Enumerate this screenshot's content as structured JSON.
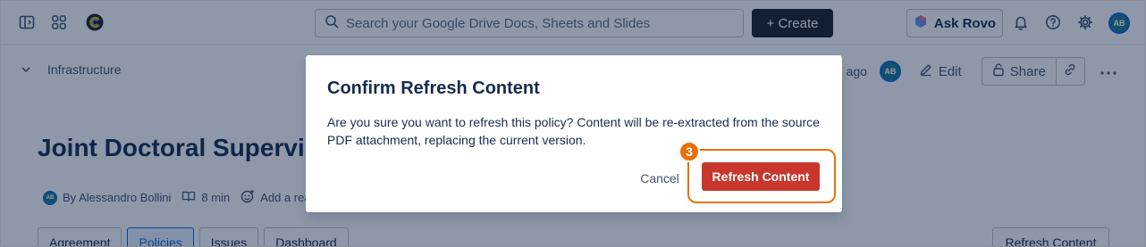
{
  "topbar": {
    "search_placeholder": "Search your Google Drive Docs, Sheets and Slides",
    "create_label": "+ Create",
    "rovo_label": "Ask Rovo",
    "avatar_initials": "AB"
  },
  "page": {
    "breadcrumb": "Infrastructure",
    "updated_text": "m ago",
    "avatar_initials": "AB",
    "edit_label": "Edit",
    "share_label": "Share",
    "title": "Joint Doctoral Supervisio",
    "author_avatar": "AB",
    "author": "By Alessandro Bollini",
    "read_time": "8 min",
    "reaction_label": "Add a rea",
    "tabs": [
      {
        "label": "Agreement"
      },
      {
        "label": "Policies"
      },
      {
        "label": "Issues"
      },
      {
        "label": "Dashboard"
      }
    ],
    "refresh_button": "Refresh Content"
  },
  "dialog": {
    "title": "Confirm Refresh Content",
    "body": "Are you sure you want to refresh this policy? Content will be re-extracted from the source PDF attachment, replacing the current version.",
    "cancel_label": "Cancel",
    "confirm_label": "Refresh Content",
    "step_number": "3"
  },
  "colors": {
    "danger": "#c9372c",
    "highlight": "#e8700a",
    "brand_dark": "#1d2125",
    "link_blue": "#0c66e4"
  }
}
